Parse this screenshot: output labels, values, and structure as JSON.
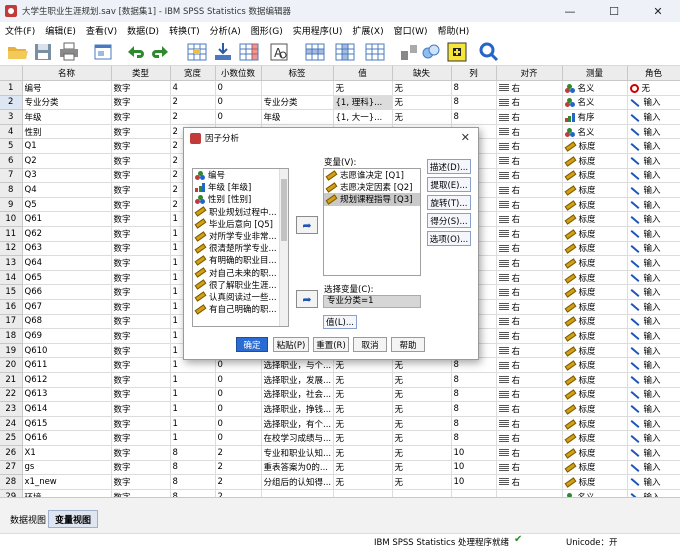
{
  "window": {
    "title": "大学生职业生涯规划.sav [数据集1] - IBM SPSS Statistics 数据编辑器",
    "minimize": "—",
    "maximize": "☐",
    "close": "✕"
  },
  "menu": [
    "文件(F)",
    "编辑(E)",
    "查看(V)",
    "数据(D)",
    "转换(T)",
    "分析(A)",
    "图形(G)",
    "实用程序(U)",
    "扩展(X)",
    "窗口(W)",
    "帮助(H)"
  ],
  "toolbar_icons": [
    "open-folder-icon",
    "save-icon",
    "print-icon",
    "dialog-recall-icon",
    "undo-icon",
    "redo-icon",
    "goto-case-icon",
    "goto-variable-icon",
    "variables-icon",
    "find-icon",
    "insert-cases-icon",
    "insert-variable-icon",
    "split-file-icon",
    "weight-cases-icon",
    "select-cases-icon",
    "value-labels-icon",
    "use-sets-icon",
    "search-icon"
  ],
  "columns": [
    "",
    "名称",
    "类型",
    "宽度",
    "小数位数",
    "标签",
    "值",
    "缺失",
    "列",
    "对齐",
    "测量",
    "角色"
  ],
  "rows": [
    {
      "n": "1",
      "name": "编号",
      "type": "数字",
      "width": "4",
      "dec": "0",
      "label": "",
      "values": "无",
      "missing": "无",
      "cols": "8",
      "align": "右",
      "measure": "名义",
      "mtype": "nominal",
      "role": "无",
      "rtype": "none"
    },
    {
      "n": "2",
      "name": "专业分类",
      "type": "数字",
      "width": "2",
      "dec": "0",
      "label": "专业分类",
      "values": "{1, 理科}...",
      "missing": "无",
      "cols": "8",
      "align": "右",
      "measure": "名义",
      "mtype": "nominal",
      "role": "输入",
      "rtype": "input"
    },
    {
      "n": "3",
      "name": "年级",
      "type": "数字",
      "width": "2",
      "dec": "0",
      "label": "年级",
      "values": "{1, 大一}...",
      "missing": "无",
      "cols": "8",
      "align": "右",
      "measure": "有序",
      "mtype": "ordinal",
      "role": "输入",
      "rtype": "input"
    },
    {
      "n": "4",
      "name": "性别",
      "type": "数字",
      "width": "2",
      "dec": "0",
      "label": "性别",
      "values": "{1, 男}...",
      "missing": "无",
      "cols": "8",
      "align": "右",
      "measure": "名义",
      "mtype": "nominal",
      "role": "输入",
      "rtype": "input"
    },
    {
      "n": "5",
      "name": "Q1",
      "type": "数字",
      "width": "2",
      "dec": "",
      "label": "",
      "values": "",
      "missing": "",
      "cols": "",
      "align": "右",
      "measure": "标度",
      "mtype": "scale",
      "role": "输入",
      "rtype": "input"
    },
    {
      "n": "6",
      "name": "Q2",
      "type": "数字",
      "width": "2",
      "dec": "",
      "label": "",
      "values": "",
      "missing": "",
      "cols": "",
      "align": "右",
      "measure": "标度",
      "mtype": "scale",
      "role": "输入",
      "rtype": "input"
    },
    {
      "n": "7",
      "name": "Q3",
      "type": "数字",
      "width": "2",
      "dec": "",
      "label": "",
      "values": "",
      "missing": "",
      "cols": "",
      "align": "右",
      "measure": "标度",
      "mtype": "scale",
      "role": "输入",
      "rtype": "input"
    },
    {
      "n": "8",
      "name": "Q4",
      "type": "数字",
      "width": "2",
      "dec": "",
      "label": "",
      "values": "",
      "missing": "",
      "cols": "",
      "align": "右",
      "measure": "标度",
      "mtype": "scale",
      "role": "输入",
      "rtype": "input"
    },
    {
      "n": "9",
      "name": "Q5",
      "type": "数字",
      "width": "2",
      "dec": "",
      "label": "",
      "values": "",
      "missing": "",
      "cols": "",
      "align": "右",
      "measure": "标度",
      "mtype": "scale",
      "role": "输入",
      "rtype": "input"
    },
    {
      "n": "10",
      "name": "Q61",
      "type": "数字",
      "width": "1",
      "dec": "",
      "label": "",
      "values": "",
      "missing": "",
      "cols": "",
      "align": "右",
      "measure": "标度",
      "mtype": "scale",
      "role": "输入",
      "rtype": "input"
    },
    {
      "n": "11",
      "name": "Q62",
      "type": "数字",
      "width": "1",
      "dec": "",
      "label": "",
      "values": "",
      "missing": "",
      "cols": "",
      "align": "右",
      "measure": "标度",
      "mtype": "scale",
      "role": "输入",
      "rtype": "input"
    },
    {
      "n": "12",
      "name": "Q63",
      "type": "数字",
      "width": "1",
      "dec": "",
      "label": "",
      "values": "",
      "missing": "",
      "cols": "",
      "align": "右",
      "measure": "标度",
      "mtype": "scale",
      "role": "输入",
      "rtype": "input"
    },
    {
      "n": "13",
      "name": "Q64",
      "type": "数字",
      "width": "1",
      "dec": "",
      "label": "",
      "values": "",
      "missing": "",
      "cols": "",
      "align": "右",
      "measure": "标度",
      "mtype": "scale",
      "role": "输入",
      "rtype": "input"
    },
    {
      "n": "14",
      "name": "Q65",
      "type": "数字",
      "width": "1",
      "dec": "",
      "label": "",
      "values": "",
      "missing": "",
      "cols": "",
      "align": "右",
      "measure": "标度",
      "mtype": "scale",
      "role": "输入",
      "rtype": "input"
    },
    {
      "n": "15",
      "name": "Q66",
      "type": "数字",
      "width": "1",
      "dec": "",
      "label": "",
      "values": "",
      "missing": "",
      "cols": "",
      "align": "右",
      "measure": "标度",
      "mtype": "scale",
      "role": "输入",
      "rtype": "input"
    },
    {
      "n": "16",
      "name": "Q67",
      "type": "数字",
      "width": "1",
      "dec": "",
      "label": "",
      "values": "",
      "missing": "",
      "cols": "",
      "align": "右",
      "measure": "标度",
      "mtype": "scale",
      "role": "输入",
      "rtype": "input"
    },
    {
      "n": "17",
      "name": "Q68",
      "type": "数字",
      "width": "1",
      "dec": "",
      "label": "",
      "values": "",
      "missing": "",
      "cols": "",
      "align": "右",
      "measure": "标度",
      "mtype": "scale",
      "role": "输入",
      "rtype": "input"
    },
    {
      "n": "18",
      "name": "Q69",
      "type": "数字",
      "width": "1",
      "dec": "",
      "label": "",
      "values": "",
      "missing": "",
      "cols": "",
      "align": "右",
      "measure": "标度",
      "mtype": "scale",
      "role": "输入",
      "rtype": "input"
    },
    {
      "n": "19",
      "name": "Q610",
      "type": "数字",
      "width": "1",
      "dec": "",
      "label": "",
      "values": "",
      "missing": "",
      "cols": "",
      "align": "右",
      "measure": "标度",
      "mtype": "scale",
      "role": "输入",
      "rtype": "input"
    },
    {
      "n": "20",
      "name": "Q611",
      "type": "数字",
      "width": "1",
      "dec": "0",
      "label": "选择职业，与个...",
      "values": "无",
      "missing": "无",
      "cols": "8",
      "align": "右",
      "measure": "标度",
      "mtype": "scale",
      "role": "输入",
      "rtype": "input"
    },
    {
      "n": "21",
      "name": "Q612",
      "type": "数字",
      "width": "1",
      "dec": "0",
      "label": "选择职业，发展...",
      "values": "无",
      "missing": "无",
      "cols": "8",
      "align": "右",
      "measure": "标度",
      "mtype": "scale",
      "role": "输入",
      "rtype": "input"
    },
    {
      "n": "22",
      "name": "Q613",
      "type": "数字",
      "width": "1",
      "dec": "0",
      "label": "选择职业，社会...",
      "values": "无",
      "missing": "无",
      "cols": "8",
      "align": "右",
      "measure": "标度",
      "mtype": "scale",
      "role": "输入",
      "rtype": "input"
    },
    {
      "n": "23",
      "name": "Q614",
      "type": "数字",
      "width": "1",
      "dec": "0",
      "label": "选择职业，挣钱...",
      "values": "无",
      "missing": "无",
      "cols": "8",
      "align": "右",
      "measure": "标度",
      "mtype": "scale",
      "role": "输入",
      "rtype": "input"
    },
    {
      "n": "24",
      "name": "Q615",
      "type": "数字",
      "width": "1",
      "dec": "0",
      "label": "选择职业，有个...",
      "values": "无",
      "missing": "无",
      "cols": "8",
      "align": "右",
      "measure": "标度",
      "mtype": "scale",
      "role": "输入",
      "rtype": "input"
    },
    {
      "n": "25",
      "name": "Q616",
      "type": "数字",
      "width": "1",
      "dec": "0",
      "label": "在校学习成绩与...",
      "values": "无",
      "missing": "无",
      "cols": "8",
      "align": "右",
      "measure": "标度",
      "mtype": "scale",
      "role": "输入",
      "rtype": "input"
    },
    {
      "n": "26",
      "name": "X1",
      "type": "数字",
      "width": "8",
      "dec": "2",
      "label": "专业和职业认知...",
      "values": "无",
      "missing": "无",
      "cols": "10",
      "align": "右",
      "measure": "标度",
      "mtype": "scale",
      "role": "输入",
      "rtype": "input"
    },
    {
      "n": "27",
      "name": "gs",
      "type": "数字",
      "width": "8",
      "dec": "2",
      "label": "重表答案为0的...",
      "values": "无",
      "missing": "无",
      "cols": "10",
      "align": "右",
      "measure": "标度",
      "mtype": "scale",
      "role": "输入",
      "rtype": "input"
    },
    {
      "n": "28",
      "name": "x1_new",
      "type": "数字",
      "width": "8",
      "dec": "2",
      "label": "分组后的认知得...",
      "values": "无",
      "missing": "无",
      "cols": "10",
      "align": "右",
      "measure": "标度",
      "mtype": "scale",
      "role": "输入",
      "rtype": "input"
    },
    {
      "n": "29",
      "name": "环境",
      "type": "数字",
      "width": "8",
      "dec": "2",
      "label": "",
      "values": "",
      "missing": "",
      "cols": "",
      "align": "",
      "measure": "名义",
      "mtype": "nominal",
      "role": "输入",
      "rtype": "input"
    }
  ],
  "dialog": {
    "title": "因子分析",
    "source_items": [
      {
        "label": "编号",
        "type": "nominal"
      },
      {
        "label": "年级 [年级]",
        "type": "ordinal"
      },
      {
        "label": "性别 [性别]",
        "type": "nominal"
      },
      {
        "label": "职业规划过程中...",
        "type": "scale"
      },
      {
        "label": "毕业后意向 [Q5]",
        "type": "scale"
      },
      {
        "label": "对所学专业非常...",
        "type": "scale"
      },
      {
        "label": "很清楚所学专业...",
        "type": "scale"
      },
      {
        "label": "有明确的职业目...",
        "type": "scale"
      },
      {
        "label": "对自己未来的职...",
        "type": "scale"
      },
      {
        "label": "很了解职业生涯...",
        "type": "scale"
      },
      {
        "label": "认真阅读过一些...",
        "type": "scale"
      },
      {
        "label": "有自己明确的职...",
        "type": "scale"
      }
    ],
    "variables_label": "变量(V):",
    "variables": [
      "志愿谁决定 [Q1]",
      "志愿决定因素 [Q2]",
      "规划课程指导 [Q3]"
    ],
    "selection_label": "选择变量(C):",
    "selection_value": "专业分类=1",
    "value_btn": "值(L)...",
    "side_buttons": [
      "描述(D)...",
      "提取(E)...",
      "旋转(T)...",
      "得分(S)...",
      "选项(O)..."
    ],
    "bottom_buttons": [
      "确定",
      "粘贴(P)",
      "重置(R)",
      "取消",
      "帮助"
    ]
  },
  "tabs": [
    "数据视图",
    "变量视图"
  ],
  "status": {
    "processor": "IBM SPSS Statistics 处理程序就绪",
    "unicode": "Unicode：开"
  }
}
